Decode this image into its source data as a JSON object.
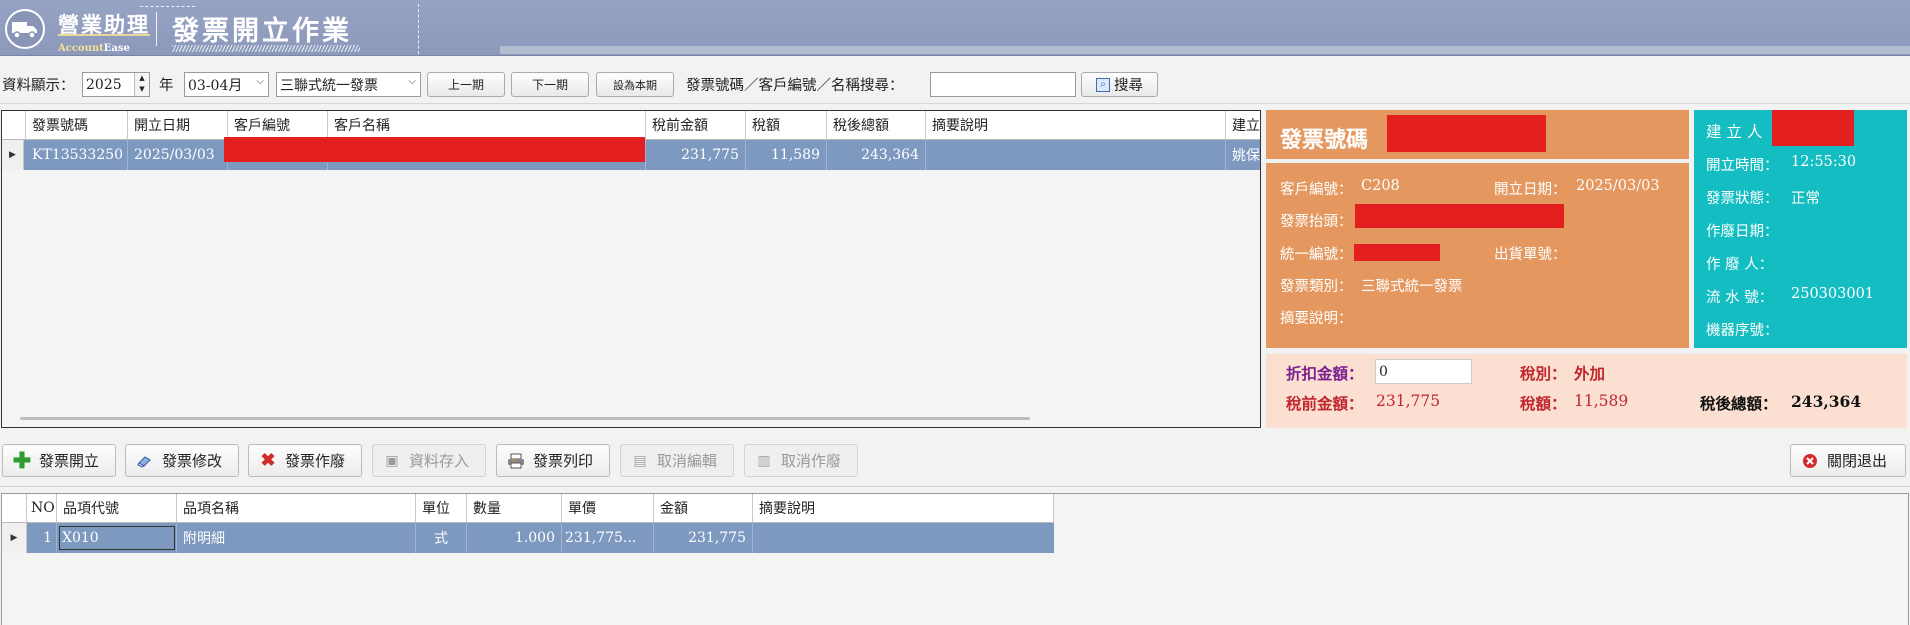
{
  "header": {
    "app_name": "營業助理",
    "app_sub_a": "Account",
    "app_sub_b": "Ease",
    "title": "發票開立作業"
  },
  "toolbar": {
    "display_label": "資料顯示：",
    "year_value": "2025",
    "year_label": "年",
    "period_value": "03-04月",
    "invoice_type_value": "三聯式統一發票",
    "prev_label": "上一期",
    "next_label": "下一期",
    "current_label": "設為本期",
    "search_label": "發票號碼／客戶編號／名稱搜尋：",
    "search_value": "",
    "search_button": "搜尋"
  },
  "invoice_grid": {
    "columns": [
      "發票號碼",
      "開立日期",
      "客戶編號",
      "客戶名稱",
      "稅前金額",
      "稅額",
      "稅後總額",
      "摘要說明",
      "建立"
    ],
    "rows": [
      {
        "invoice_no": "KT13533250",
        "date": "2025/03/03",
        "customer_id": "",
        "customer_name": "",
        "pretax": "231,775",
        "tax": "11,589",
        "total": "243,364",
        "note": "",
        "creator": "姚保"
      }
    ]
  },
  "invoice_panel": {
    "no_label": "發票號碼",
    "customer_id_label": "客戶編號：",
    "customer_id_value": "C208",
    "issue_date_label": "開立日期：",
    "issue_date_value": "2025/03/03",
    "header_label": "發票抬頭：",
    "tax_id_label": "統一編號：",
    "ship_no_label": "出貨單號：",
    "type_label": "發票類別：",
    "type_value": "三聯式統一發票",
    "note_label": "摘要說明："
  },
  "meta_panel": {
    "creator_label": "建 立 人",
    "time_label": "開立時間：",
    "time_value": "12:55:30",
    "status_label": "發票狀態：",
    "status_value": "正常",
    "void_date_label": "作廢日期：",
    "void_by_label": "作 廢 人：",
    "serial_label": "流 水 號：",
    "serial_value": "250303001",
    "machine_label": "機器序號："
  },
  "summary": {
    "discount_label": "折扣金額：",
    "discount_value": "0",
    "tax_type_label": "稅別：",
    "tax_type_value": "外加",
    "pretax_label": "稅前金額：",
    "pretax_value": "231,775",
    "tax_label": "稅額：",
    "tax_value": "11,589",
    "total_label": "稅後總額：",
    "total_value": "243,364"
  },
  "actions": {
    "create": "發票開立",
    "edit": "發票修改",
    "void": "發票作廢",
    "save": "資料存入",
    "print": "發票列印",
    "cancel_edit": "取消編輯",
    "cancel_void": "取消作廢",
    "close": "關閉退出"
  },
  "items_grid": {
    "columns": [
      "NO",
      "品項代號",
      "品項名稱",
      "單位",
      "數量",
      "單價",
      "金額",
      "摘要說明"
    ],
    "rows": [
      {
        "no": "1",
        "code": "X010",
        "name": "附明細",
        "unit": "式",
        "qty": "1.000",
        "price": "231,775...",
        "amount": "231,775",
        "note": ""
      }
    ]
  }
}
